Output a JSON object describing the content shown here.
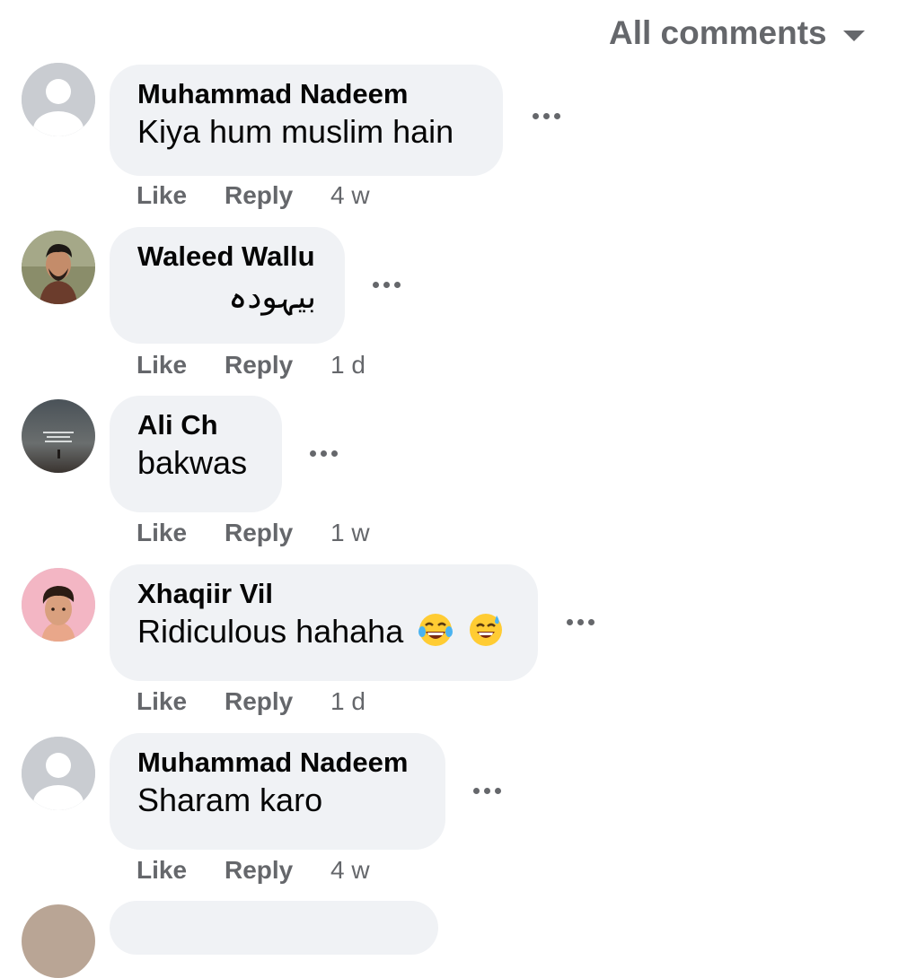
{
  "header": {
    "filter_label": "All comments",
    "filter_icon": "caret-down-icon"
  },
  "actions": {
    "like": "Like",
    "reply": "Reply"
  },
  "comments": [
    {
      "author": "Muhammad Nadeem",
      "text": "Kiya hum muslim hain",
      "time": "4 w",
      "avatar": "default-avatar-icon"
    },
    {
      "author": "Waleed Wallu",
      "text": "بیہودہ",
      "time": "1 d",
      "avatar": "profile-photo"
    },
    {
      "author": "Ali Ch",
      "text": "bakwas",
      "time": "1 w",
      "avatar": "profile-photo"
    },
    {
      "author": "Xhaqiir Vil",
      "text": "Ridiculous hahaha",
      "emojis": [
        "laughing-tears-emoji",
        "sweat-smile-emoji"
      ],
      "time": "1 d",
      "avatar": "profile-photo"
    },
    {
      "author": "Muhammad Nadeem",
      "text": "Sharam karo",
      "time": "4 w",
      "avatar": "default-avatar-icon"
    }
  ]
}
